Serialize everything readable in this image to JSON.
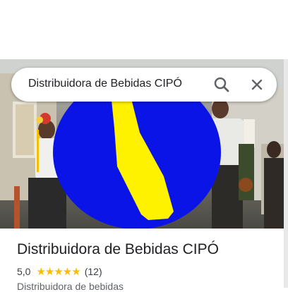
{
  "search": {
    "query": "Distribuidora de Bebidas CIPÓ",
    "search_icon": "search-icon",
    "close_icon": "close-icon"
  },
  "place": {
    "name": "Distribuidora de Bebidas CIPÓ",
    "rating": "5,0",
    "stars": "★★★★★",
    "review_count": "(12)",
    "category": "Distribuidora de bebidas"
  },
  "colors": {
    "logo_blue": "#0a14e6",
    "logo_yellow": "#fff200",
    "star": "#fbbc04"
  }
}
